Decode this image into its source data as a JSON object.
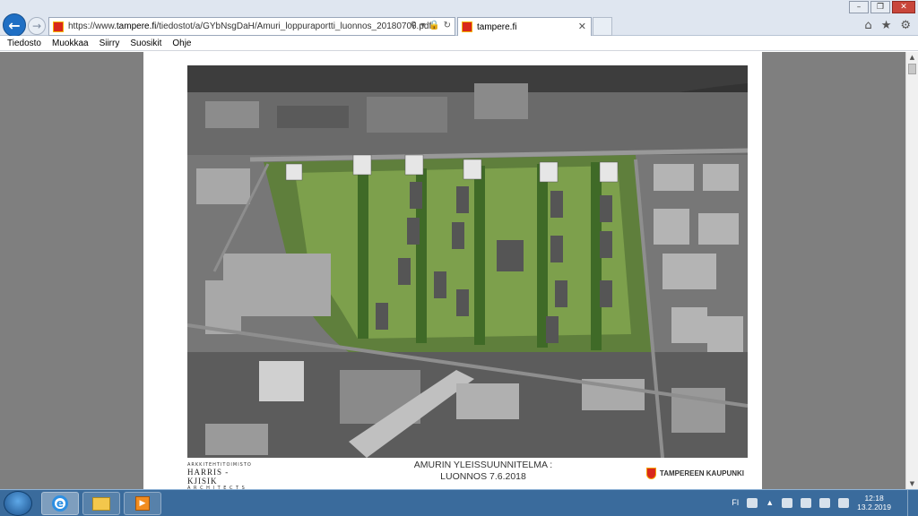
{
  "browser": {
    "url_prefix": "https://www.",
    "url_domain": "tampere.fi",
    "url_path": "/tiedostot/a/GYbNsgDaH/Amuri_loppuraportti_luonnos_20180706.pdf",
    "tab_title": "tampere.fi",
    "menu": [
      "Tiedosto",
      "Muokkaa",
      "Siirry",
      "Suosikit",
      "Ohje"
    ]
  },
  "document": {
    "architect_small": "ARKKITEHTITOIMISTO",
    "architect_name": "HARRIS - KJISIK",
    "architect_sub": "A R C H I T E C T S",
    "title_line1": "AMURIN YLEISSUUNNITELMA :",
    "title_line2": "LUONNOS 7.6.2018",
    "city_name": "TAMPEREEN KAUPUNKI"
  },
  "taskbar": {
    "language": "FI",
    "time": "12:18",
    "date": "13.2.2019"
  },
  "colors": {
    "accent": "#1f6fc4",
    "taskbar": "#3a6b9c",
    "city_red": "#d8281c"
  }
}
